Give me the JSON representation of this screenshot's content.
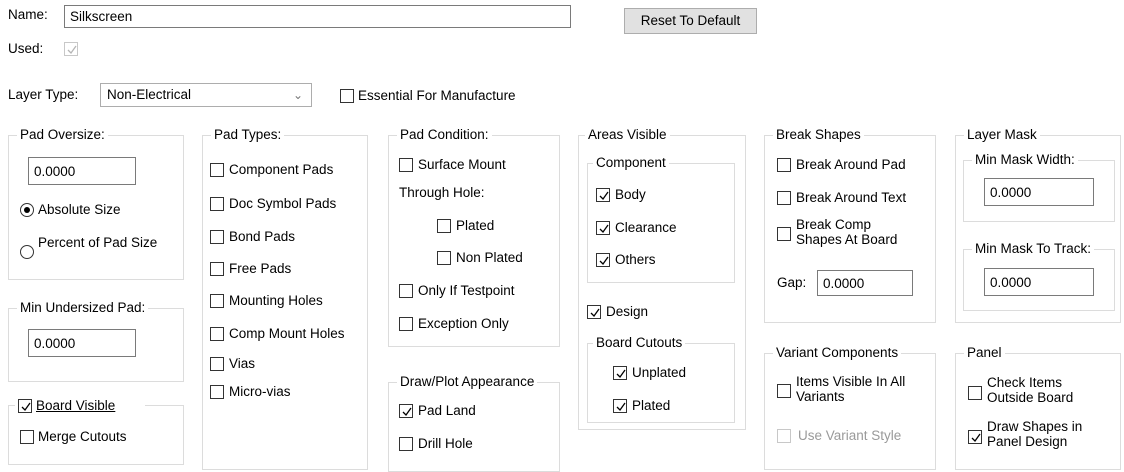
{
  "name": {
    "label": "Name:",
    "value": "Silkscreen"
  },
  "reset_button": "Reset To Default",
  "used": {
    "label": "Used:",
    "checked": true,
    "enabled": false
  },
  "layer_type": {
    "label": "Layer Type:",
    "value": "Non-Electrical"
  },
  "essential_for_manufacture": {
    "label": "Essential For Manufacture",
    "checked": false
  },
  "pad_oversize": {
    "title": "Pad Oversize:",
    "value": "0.0000",
    "absolute_size": "Absolute Size",
    "percent_of_pad_size": "Percent of Pad Size",
    "selected": "absolute"
  },
  "min_undersized_pad": {
    "title": "Min Undersized Pad:",
    "value": "0.0000"
  },
  "board_visible": {
    "label": "Board Visible",
    "checked": true,
    "merge_cutouts": {
      "label": "Merge Cutouts",
      "checked": false
    }
  },
  "pad_types": {
    "title": "Pad Types:",
    "items": [
      {
        "label": "Component Pads",
        "checked": false
      },
      {
        "label": "Doc Symbol Pads",
        "checked": false
      },
      {
        "label": "Bond Pads",
        "checked": false
      },
      {
        "label": "Free Pads",
        "checked": false
      },
      {
        "label": "Mounting Holes",
        "checked": false
      },
      {
        "label": "Comp Mount Holes",
        "checked": false
      },
      {
        "label": "Vias",
        "checked": false
      },
      {
        "label": "Micro-vias",
        "checked": false
      }
    ]
  },
  "pad_condition": {
    "title": "Pad Condition:",
    "surface_mount": {
      "label": "Surface Mount",
      "checked": false
    },
    "through_hole_label": "Through Hole:",
    "plated": {
      "label": "Plated",
      "checked": false
    },
    "non_plated": {
      "label": "Non Plated",
      "checked": false
    },
    "only_if_testpoint": {
      "label": "Only If Testpoint",
      "checked": false
    },
    "exception_only": {
      "label": "Exception Only",
      "checked": false
    }
  },
  "draw_plot_appearance": {
    "title": "Draw/Plot Appearance",
    "pad_land": {
      "label": "Pad Land",
      "checked": true
    },
    "drill_hole": {
      "label": "Drill Hole",
      "checked": false
    }
  },
  "areas_visible": {
    "title": "Areas Visible",
    "component_title": "Component",
    "body": {
      "label": "Body",
      "checked": true
    },
    "clearance": {
      "label": "Clearance",
      "checked": true
    },
    "others": {
      "label": "Others",
      "checked": true
    },
    "design": {
      "label": "Design",
      "checked": true
    },
    "board_cutouts_title": "Board Cutouts",
    "unplated": {
      "label": "Unplated",
      "checked": true
    },
    "plated": {
      "label": "Plated",
      "checked": true
    }
  },
  "break_shapes": {
    "title": "Break Shapes",
    "break_around_pad": {
      "label": "Break Around Pad",
      "checked": false
    },
    "break_around_text": {
      "label": "Break Around Text",
      "checked": false
    },
    "break_comp_shapes_line1": "Break Comp",
    "break_comp_shapes_line2": "Shapes At Board",
    "gap_label": "Gap:",
    "gap_value": "0.0000"
  },
  "variant_components": {
    "title": "Variant Components",
    "items_visible_line1": "Items Visible In All",
    "items_visible_line2": "Variants",
    "use_variant_style": "Use Variant Style"
  },
  "layer_mask": {
    "title": "Layer Mask",
    "min_mask_width_title": "Min Mask Width:",
    "min_mask_width_value": "0.0000",
    "min_mask_to_track_title": "Min Mask To Track:",
    "min_mask_to_track_value": "0.0000"
  },
  "panel": {
    "title": "Panel",
    "check_items_line1": "Check Items",
    "check_items_line2": "Outside Board",
    "draw_shapes_line1": "Draw Shapes in",
    "draw_shapes_line2": "Panel Design",
    "check_items_checked": false,
    "draw_shapes_checked": true
  }
}
